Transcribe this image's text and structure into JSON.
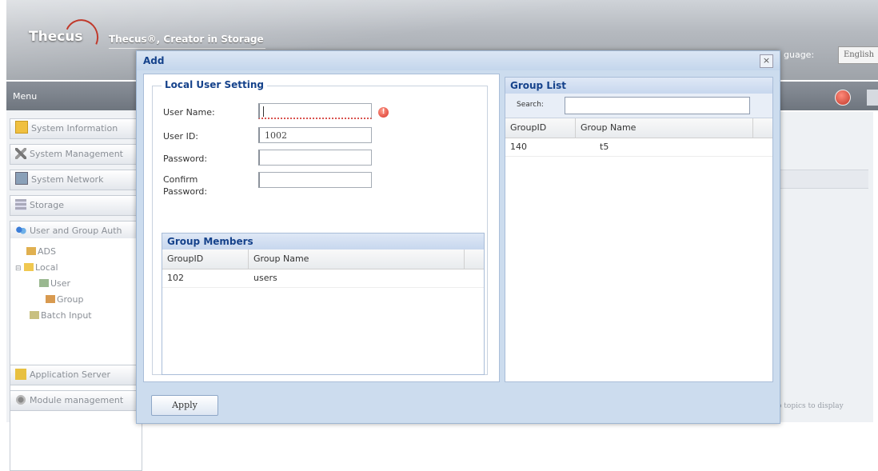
{
  "header": {
    "logo": "Thecus",
    "tagline": "Thecus®, Creator in Storage",
    "language_label": "guage:",
    "language_value": "English"
  },
  "menubar": {
    "title": "Menu"
  },
  "sidebar": {
    "items": [
      {
        "label": "System Information",
        "icon": "info-icon"
      },
      {
        "label": "System Management",
        "icon": "tools-icon"
      },
      {
        "label": "System Network",
        "icon": "network-icon"
      },
      {
        "label": "Storage",
        "icon": "storage-icon"
      },
      {
        "label": "User and Group Auth",
        "icon": "users-icon"
      }
    ],
    "tree": {
      "ads": "ADS",
      "local": "Local",
      "user": "User",
      "group": "Group",
      "batch": "Batch Input"
    },
    "bottom_items": [
      {
        "label": "Application Server",
        "icon": "app-server-icon"
      },
      {
        "label": "Module management",
        "icon": "module-icon"
      }
    ]
  },
  "background": {
    "footer_text": "o topics to display"
  },
  "dialog": {
    "title": "Add",
    "close_label": "×",
    "local_user_setting": {
      "legend": "Local User Setting",
      "fields": {
        "user_name_label": "User Name:",
        "user_name_value": "",
        "user_id_label": "User ID:",
        "user_id_value": "1002",
        "password_label": "Password:",
        "password_value": "",
        "confirm_label_1": "Confirm",
        "confirm_label_2": "Password:",
        "confirm_value": ""
      },
      "error_icon": "!"
    },
    "group_members": {
      "title": "Group Members",
      "columns": [
        "GroupID",
        "Group Name"
      ],
      "rows": [
        {
          "id": "102",
          "name": "users"
        }
      ]
    },
    "group_list": {
      "title": "Group List",
      "search_label": "Search:",
      "search_value": "",
      "columns": [
        "GroupID",
        "Group Name"
      ],
      "rows": [
        {
          "id": "140",
          "name": "t5"
        }
      ]
    },
    "apply_label": "Apply"
  }
}
